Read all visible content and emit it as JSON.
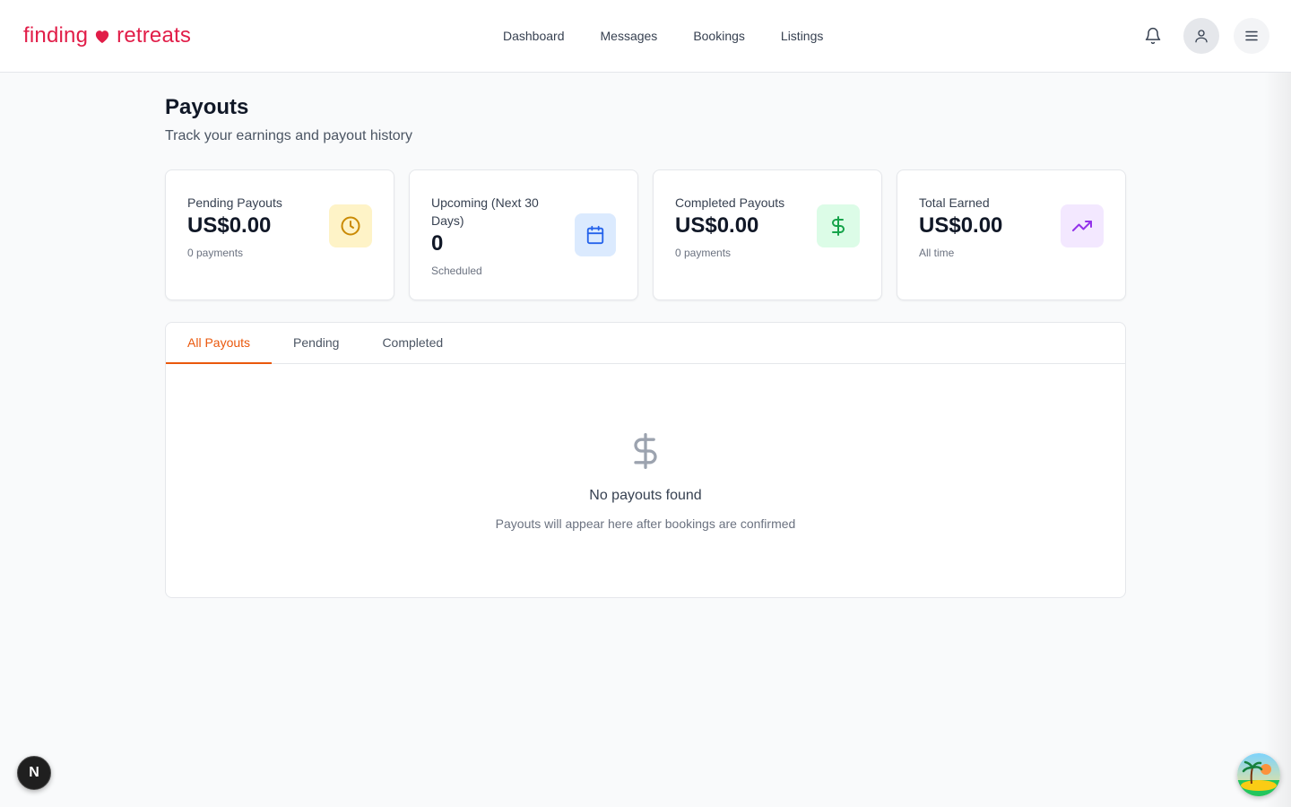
{
  "brand": {
    "text_left": "finding",
    "text_right": "retreats",
    "color": "#e11d48"
  },
  "nav": {
    "items": [
      "Dashboard",
      "Messages",
      "Bookings",
      "Listings"
    ]
  },
  "header_icons": {
    "notifications": "bell-icon",
    "profile": "user-icon",
    "menu": "menu-icon"
  },
  "page": {
    "title": "Payouts",
    "subtitle": "Track your earnings and payout history"
  },
  "stats": [
    {
      "label": "Pending Payouts",
      "value": "US$0.00",
      "sub": "0 payments",
      "icon": "clock-icon",
      "icon_bg": "#fef3c7",
      "icon_color": "#ca8a04"
    },
    {
      "label": "Upcoming (Next 30 Days)",
      "value": "0",
      "sub": "Scheduled",
      "icon": "calendar-icon",
      "icon_bg": "#dbeafe",
      "icon_color": "#2563eb"
    },
    {
      "label": "Completed Payouts",
      "value": "US$0.00",
      "sub": "0 payments",
      "icon": "dollar-icon",
      "icon_bg": "#dcfce7",
      "icon_color": "#16a34a"
    },
    {
      "label": "Total Earned",
      "value": "US$0.00",
      "sub": "All time",
      "icon": "trending-up-icon",
      "icon_bg": "#f3e8ff",
      "icon_color": "#9333ea"
    }
  ],
  "tabs": {
    "items": [
      "All Payouts",
      "Pending",
      "Completed"
    ],
    "active": "All Payouts",
    "accent": "#ea580c"
  },
  "empty_state": {
    "icon": "dollar-icon",
    "title": "No payouts found",
    "description": "Payouts will appear here after bookings are confirmed"
  },
  "overlays": {
    "dev_badge": "N",
    "support": "support-avatar"
  }
}
